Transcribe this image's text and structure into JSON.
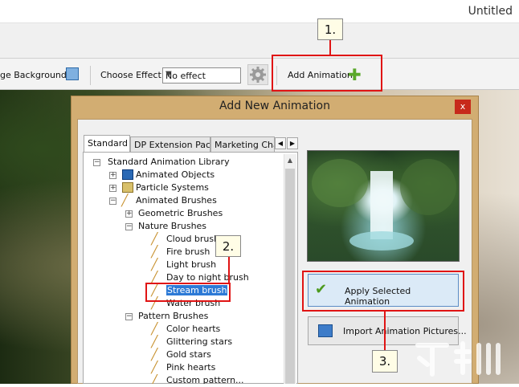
{
  "app": {
    "title": "Untitled"
  },
  "toolbar": {
    "background_label": "ge Background",
    "choose_effect_label": "Choose Effect:",
    "effect_value": "No effect",
    "add_animation_label": "Add Animation"
  },
  "dialog": {
    "title": "Add New Animation",
    "close_glyph": "x",
    "tabs": [
      "Standard",
      "DP Extension Pack",
      "Marketing Char"
    ],
    "tree": {
      "root": "Standard Animation Library",
      "animated_objects": "Animated Objects",
      "particle_systems": "Particle Systems",
      "animated_brushes": "Animated Brushes",
      "geometric_brushes": "Geometric Brushes",
      "nature_brushes": "Nature Brushes",
      "nature_items": [
        "Cloud brush",
        "Fire brush",
        "Light brush",
        "Day to night brush",
        "Stream brush",
        "Water brush"
      ],
      "pattern_brushes": "Pattern Brushes",
      "pattern_items": [
        "Color hearts",
        "Glittering stars",
        "Gold stars",
        "Pink hearts",
        "Custom pattern..."
      ]
    },
    "selected_item": "Stream brush",
    "apply_button": "Apply Selected Animation",
    "import_button": "Import Animation Pictures..."
  },
  "callouts": {
    "c1": "1.",
    "c2": "2.",
    "c3": "3."
  },
  "colors": {
    "highlight_red": "#e01414",
    "dialog_frame": "#d2ad72",
    "selection_blue": "#2d7ad6"
  }
}
